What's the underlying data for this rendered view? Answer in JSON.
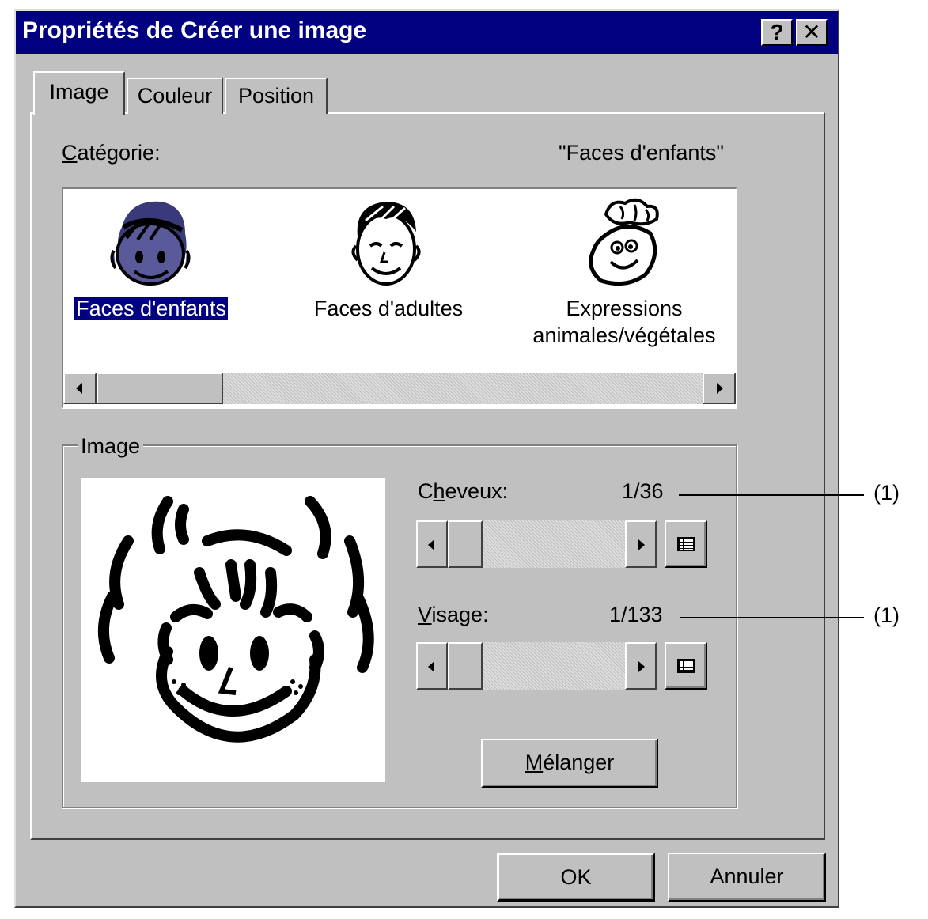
{
  "window": {
    "title": "Propriétés de Créer une image",
    "help_label": "?",
    "close_label": "✕"
  },
  "tabs": [
    {
      "label": "Image",
      "active": true
    },
    {
      "label": "Couleur",
      "active": false
    },
    {
      "label": "Position",
      "active": false
    }
  ],
  "category": {
    "label_prefix": "C",
    "label_rest": "atégorie:",
    "current_value": "\"Faces d'enfants\"",
    "items": [
      {
        "label": "Faces d'enfants",
        "icon": "child-face-icon",
        "selected": true
      },
      {
        "label": "Faces d'adultes",
        "icon": "adult-face-icon",
        "selected": false
      },
      {
        "label_line1": "Expressions",
        "label_line2": "animales/végétales",
        "icon": "vegetable-face-icon",
        "selected": false
      }
    ]
  },
  "image_group": {
    "legend": "Image",
    "preview_icon": "child-face-preview-icon",
    "hair": {
      "label_pre": "C",
      "label_mnemonic": "h",
      "label_post": "eveux:",
      "value": "1/36",
      "callout": "(1)",
      "position": 1,
      "total": 36
    },
    "face": {
      "label_mnemonic": "V",
      "label_post": "isage:",
      "value": "1/133",
      "callout": "(1)",
      "position": 1,
      "total": 133
    },
    "shuffle_mnemonic": "M",
    "shuffle_rest": "élanger"
  },
  "buttons": {
    "ok": "OK",
    "cancel": "Annuler"
  },
  "colors": {
    "title_bar": "#000080",
    "face_fill": "#5a5a9a",
    "dialog_bg": "#c0c0c0"
  }
}
